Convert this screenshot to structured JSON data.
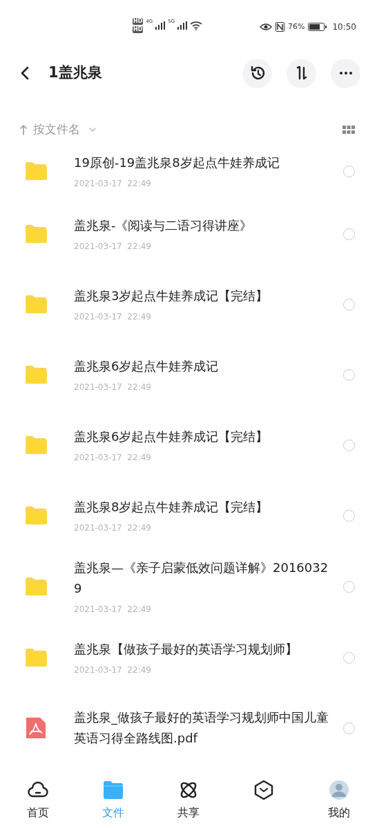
{
  "status_bar": {
    "network_labels": [
      "4G",
      "5G"
    ],
    "sim_labels": [
      "HD",
      "HD"
    ],
    "battery": "76%",
    "time": "10:50"
  },
  "header": {
    "title": "1盖兆泉"
  },
  "sort_bar": {
    "label": "按文件名"
  },
  "files": [
    {
      "kind": "folder",
      "name": "19原创-19盖兆泉8岁起点牛娃养成记",
      "date": "2021-03-17  22:49",
      "selected": false
    },
    {
      "kind": "folder",
      "name": "盖兆泉-《阅读与二语习得讲座》",
      "date": "2021-03-17  22:49",
      "selected": false
    },
    {
      "kind": "folder",
      "name": "盖兆泉3岁起点牛娃养成记【完结】",
      "date": "2021-03-17  22:49",
      "selected": false
    },
    {
      "kind": "folder",
      "name": "盖兆泉6岁起点牛娃养成记",
      "date": "2021-03-17  22:49",
      "selected": false
    },
    {
      "kind": "folder",
      "name": "盖兆泉6岁起点牛娃养成记【完结】",
      "date": "2021-03-17  22:49",
      "selected": false
    },
    {
      "kind": "folder",
      "name": "盖兆泉8岁起点牛娃养成记【完结】",
      "date": "2021-03-17  22:49",
      "selected": false
    },
    {
      "kind": "folder",
      "name": "盖兆泉—《亲子启蒙低效问题详解》20160329",
      "date": "2021-03-17  22:49",
      "selected": false
    },
    {
      "kind": "folder",
      "name": "盖兆泉【做孩子最好的英语学习规划师】",
      "date": "2021-03-17  22:49",
      "selected": false
    },
    {
      "kind": "pdf",
      "name": "盖兆泉_做孩子最好的英语学习规划师中国儿童英语习得全路线图.pdf",
      "selected": false
    }
  ],
  "tabs": [
    {
      "kind": "cloud",
      "label": "首页",
      "selected": false
    },
    {
      "kind": "folder",
      "label": "文件",
      "selected": true
    },
    {
      "kind": "atom",
      "label": "共享",
      "selected": false
    },
    {
      "kind": "hexagon",
      "selected": false
    },
    {
      "kind": "avatar",
      "label": "我的",
      "selected": false
    }
  ]
}
